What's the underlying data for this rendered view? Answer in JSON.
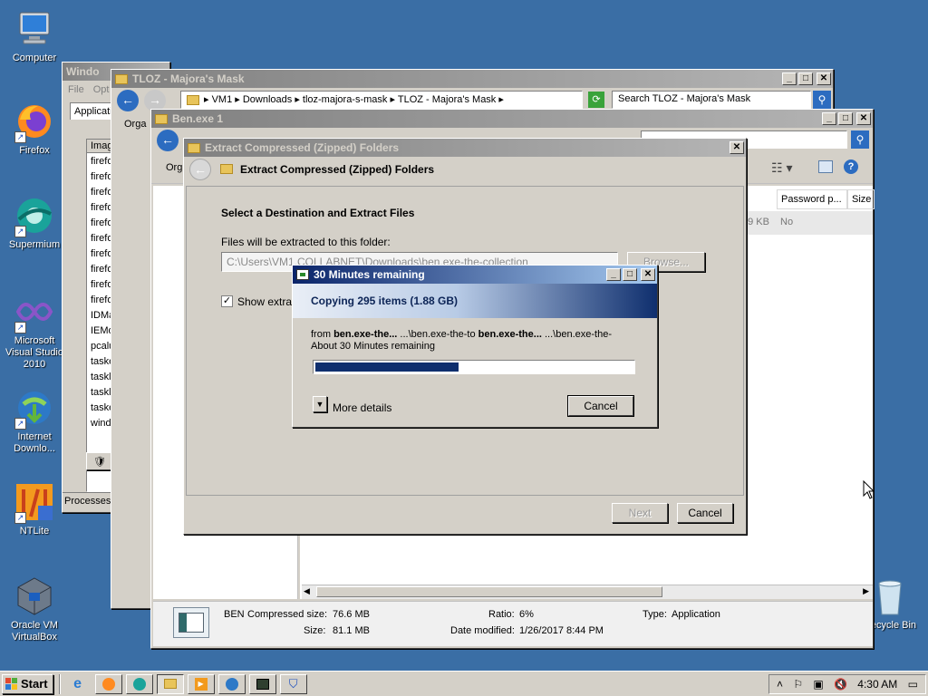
{
  "desktop": {
    "icons": [
      {
        "label": "Computer"
      },
      {
        "label": "Firefox"
      },
      {
        "label": "Supermium"
      },
      {
        "label": "Microsoft Visual Studio 2010"
      },
      {
        "label": "Internet Downlo..."
      },
      {
        "label": "NTLite"
      },
      {
        "label": "Oracle VM VirtualBox"
      },
      {
        "label": "Recycle Bin"
      }
    ]
  },
  "task_manager": {
    "title": "Windo",
    "menu": [
      "File",
      "Opt"
    ],
    "tab": "Applicati",
    "column": "Imag",
    "processes": [
      "firefo",
      "firefo",
      "firefo",
      "firefo",
      "firefo",
      "firefo",
      "firefo",
      "firefo",
      "firefo",
      "firefo",
      "IDMa",
      "IEMo",
      "pcalu",
      "taske",
      "taskl",
      "taskl",
      "taske",
      "windo"
    ],
    "status": "Processes:"
  },
  "explorer_back": {
    "title": "TLOZ - Majora's Mask",
    "breadcrumb": [
      "VM1",
      "Downloads",
      "tloz-majora-s-mask",
      "TLOZ - Majora's Mask"
    ],
    "search_placeholder": "Search TLOZ - Majora's Mask",
    "organize": "Orga"
  },
  "explorer_front": {
    "title": "Ben.exe 1",
    "organize": "Org",
    "columns": [
      "Password p...",
      "Size"
    ],
    "row": {
      "size": "49 KB",
      "password": "No"
    },
    "details": {
      "name": "BEN",
      "type_label": "Type:",
      "type": "Application",
      "compressed_label": "Compressed size:",
      "compressed": "76.6 MB",
      "size_label": "Size:",
      "size": "81.1 MB",
      "ratio_label": "Ratio:",
      "ratio": "6%",
      "modified_label": "Date modified:",
      "modified": "1/26/2017 8:44 PM"
    }
  },
  "extract_wizard": {
    "title": "Extract Compressed (Zipped) Folders",
    "header": "Extract Compressed (Zipped) Folders",
    "section_title": "Select a Destination and Extract Files",
    "path_label": "Files will be extracted to this folder:",
    "path_value": "C:\\Users\\VM1.COLLABNET\\Downloads\\ben.exe-the-collection",
    "browse": "Browse...",
    "show_checkbox": "Show extrac",
    "next": "Next",
    "cancel": "Cancel"
  },
  "copy_dialog": {
    "title": "30 Minutes remaining",
    "heading": "Copying 295 items (1.88 GB)",
    "from_prefix": "from ",
    "from_name": "ben.exe-the...",
    "from_path": " ...\\ben.exe-the-to ",
    "to_name": "ben.exe-the...",
    "to_path": " ...\\ben.exe-the-",
    "remaining": "About 30 Minutes remaining",
    "progress": 0.45,
    "more_details": "More details",
    "cancel": "Cancel"
  },
  "taskbar": {
    "start": "Start",
    "clock": "4:30 AM"
  }
}
